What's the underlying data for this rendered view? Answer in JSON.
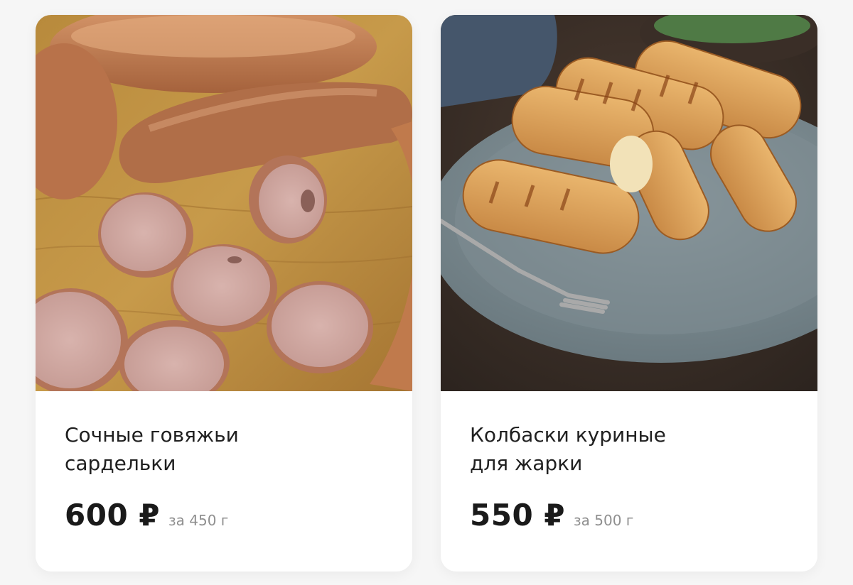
{
  "products": [
    {
      "title": "Сочные говяжьи\nсардельки",
      "price": "600 ₽",
      "unit": "за 450 г",
      "image": "sliced-beef-sausages-photo"
    },
    {
      "title": "Колбаски куриные\nдля жарки",
      "price": "550 ₽",
      "unit": "за 500 г",
      "image": "grilled-chicken-sausages-photo"
    }
  ]
}
